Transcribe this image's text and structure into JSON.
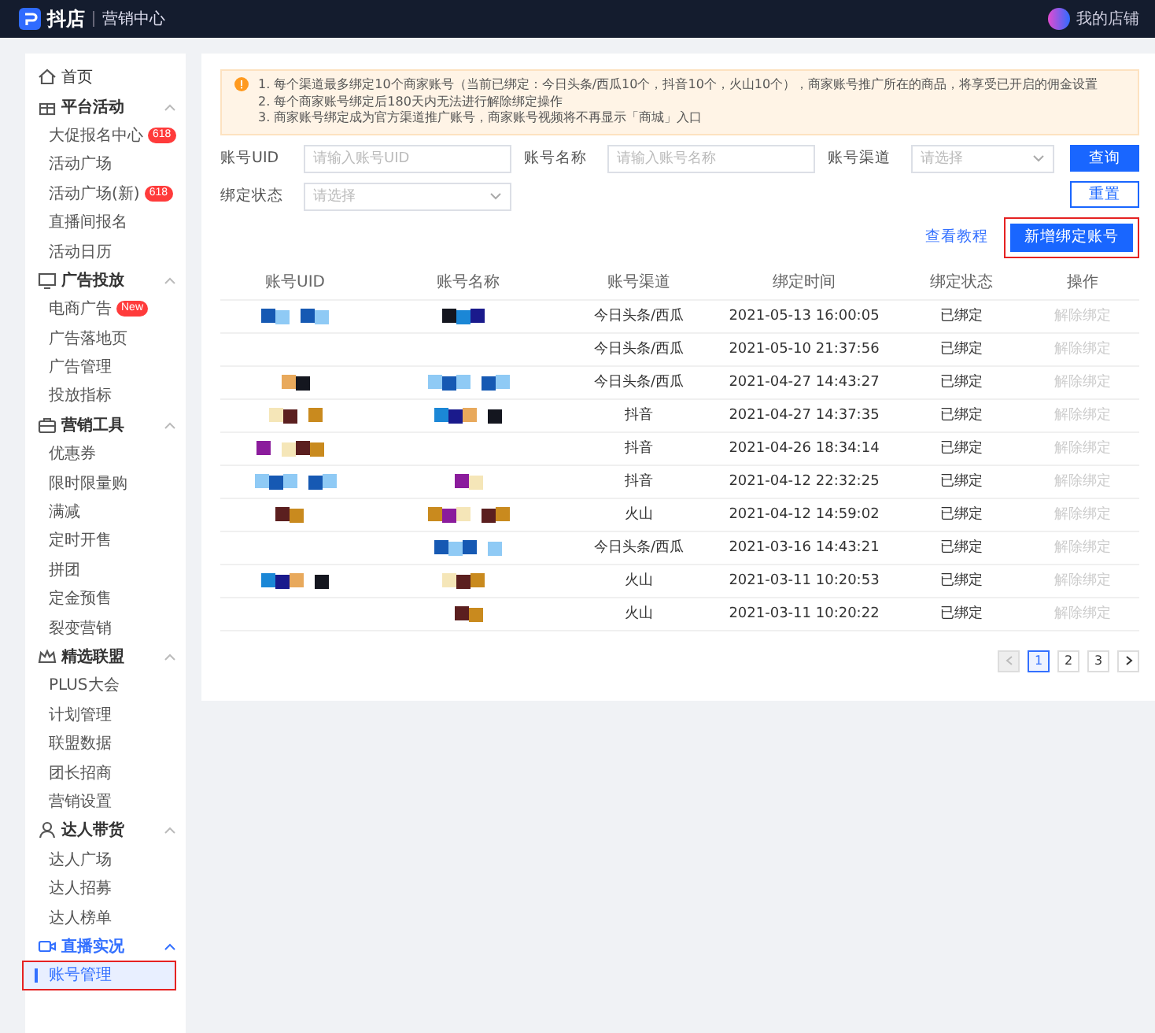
{
  "header": {
    "logo": "抖店",
    "section": "营销中心",
    "user_name": "我的店铺"
  },
  "sidebar": {
    "items": [
      {
        "kind": "link",
        "label": "首页"
      },
      {
        "kind": "group",
        "label": "平台活动",
        "expanded": true,
        "children": [
          {
            "label": "大促报名中心",
            "badge": "618",
            "selected": false,
            "highlighted": false
          },
          {
            "label": "活动广场",
            "selected": false,
            "highlighted": false
          },
          {
            "label": "活动广场(新)",
            "badge": "618",
            "selected": false,
            "highlighted": false
          },
          {
            "label": "直播间报名",
            "selected": false,
            "highlighted": false
          },
          {
            "label": "活动日历",
            "selected": false,
            "highlighted": false
          }
        ]
      },
      {
        "kind": "group",
        "label": "广告投放",
        "expanded": true,
        "children": [
          {
            "label": "电商广告",
            "badge": "New",
            "selected": false,
            "highlighted": false
          },
          {
            "label": "广告落地页",
            "selected": false,
            "highlighted": false
          },
          {
            "label": "广告管理",
            "selected": false,
            "highlighted": false
          },
          {
            "label": "投放指标",
            "selected": false,
            "highlighted": false
          }
        ]
      },
      {
        "kind": "group",
        "label": "营销工具",
        "expanded": true,
        "children": [
          {
            "label": "优惠券",
            "selected": false,
            "highlighted": false
          },
          {
            "label": "限时限量购",
            "selected": false,
            "highlighted": false
          },
          {
            "label": "满减",
            "selected": false,
            "highlighted": false
          },
          {
            "label": "定时开售",
            "selected": false,
            "highlighted": false
          },
          {
            "label": "拼团",
            "selected": false,
            "highlighted": false
          },
          {
            "label": "定金预售",
            "selected": false,
            "highlighted": false
          },
          {
            "label": "裂变营销",
            "selected": false,
            "highlighted": false
          }
        ]
      },
      {
        "kind": "group",
        "label": "精选联盟",
        "expanded": true,
        "children": [
          {
            "label": "PLUS大会",
            "selected": false,
            "highlighted": false
          },
          {
            "label": "计划管理",
            "selected": false,
            "highlighted": false
          },
          {
            "label": "联盟数据",
            "selected": false,
            "highlighted": false
          },
          {
            "label": "团长招商",
            "selected": false,
            "highlighted": false
          },
          {
            "label": "营销设置",
            "selected": false,
            "highlighted": false
          }
        ]
      },
      {
        "kind": "group",
        "label": "达人带货",
        "expanded": true,
        "children": [
          {
            "label": "达人广场",
            "selected": false,
            "highlighted": false
          },
          {
            "label": "达人招募",
            "selected": false,
            "highlighted": false
          },
          {
            "label": "达人榜单",
            "selected": false,
            "highlighted": false
          }
        ]
      },
      {
        "kind": "group",
        "label": "直播实况",
        "expanded": true,
        "children": [
          {
            "label": "账号管理",
            "selected": true,
            "highlighted": true
          }
        ]
      }
    ]
  },
  "notice": {
    "lines": [
      "1. 每个渠道最多绑定10个商家账号（当前已绑定：今日头条/西瓜10个，抖音10个，火山10个），商家账号推广所在的商品，将享受已开启的佣金设置",
      "2. 每个商家账号绑定后180天内无法进行解除绑定操作",
      "3. 商家账号绑定成为官方渠道推广账号，商家账号视频将不再显示「商城」入口"
    ]
  },
  "filters": [
    {
      "kind": "input",
      "label": "账号UID",
      "placeholder": "请输入账号UID"
    },
    {
      "kind": "input",
      "label": "账号名称",
      "placeholder": "请输入账号名称"
    },
    {
      "kind": "select",
      "label": "账号渠道",
      "placeholder": "请选择"
    },
    {
      "kind": "select",
      "label": "绑定状态",
      "placeholder": "请选择"
    }
  ],
  "actions": {
    "search": "查询",
    "reset": "重置",
    "tutorial_link": "查看教程",
    "add_button": {
      "label": "新增绑定账号",
      "highlighted": true
    }
  },
  "table": {
    "columns": [
      "账号UID",
      "账号名称",
      "账号渠道",
      "绑定时间",
      "绑定状态",
      "操作"
    ],
    "rows": [
      {
        "channel": "今日头条/西瓜",
        "bind_time": "2021-05-13 16:00:05",
        "status": "已绑定",
        "action": "解除绑定",
        "action_disabled": true
      },
      {
        "channel": "今日头条/西瓜",
        "bind_time": "2021-05-10 21:37:56",
        "status": "已绑定",
        "action": "解除绑定",
        "action_disabled": true
      },
      {
        "channel": "今日头条/西瓜",
        "bind_time": "2021-04-27 14:43:27",
        "status": "已绑定",
        "action": "解除绑定",
        "action_disabled": true
      },
      {
        "channel": "抖音",
        "bind_time": "2021-04-27 14:37:35",
        "status": "已绑定",
        "action": "解除绑定",
        "action_disabled": true
      },
      {
        "channel": "抖音",
        "bind_time": "2021-04-26 18:34:14",
        "status": "已绑定",
        "action": "解除绑定",
        "action_disabled": true
      },
      {
        "channel": "抖音",
        "bind_time": "2021-04-12 22:32:25",
        "status": "已绑定",
        "action": "解除绑定",
        "action_disabled": true
      },
      {
        "channel": "火山",
        "bind_time": "2021-04-12 14:59:02",
        "status": "已绑定",
        "action": "解除绑定",
        "action_disabled": true
      },
      {
        "channel": "今日头条/西瓜",
        "bind_time": "2021-03-16 14:43:21",
        "status": "已绑定",
        "action": "解除绑定",
        "action_disabled": true
      },
      {
        "channel": "火山",
        "bind_time": "2021-03-11 10:20:53",
        "status": "已绑定",
        "action": "解除绑定",
        "action_disabled": true
      },
      {
        "channel": "火山",
        "bind_time": "2021-03-11 10:20:22",
        "status": "已绑定",
        "action": "解除绑定",
        "action_disabled": true
      }
    ]
  },
  "pagination": {
    "prev_disabled": true,
    "next_disabled": false,
    "pages": [
      {
        "label": "1",
        "selected": true
      },
      {
        "label": "2",
        "selected": false
      },
      {
        "label": "3",
        "selected": false
      }
    ]
  }
}
